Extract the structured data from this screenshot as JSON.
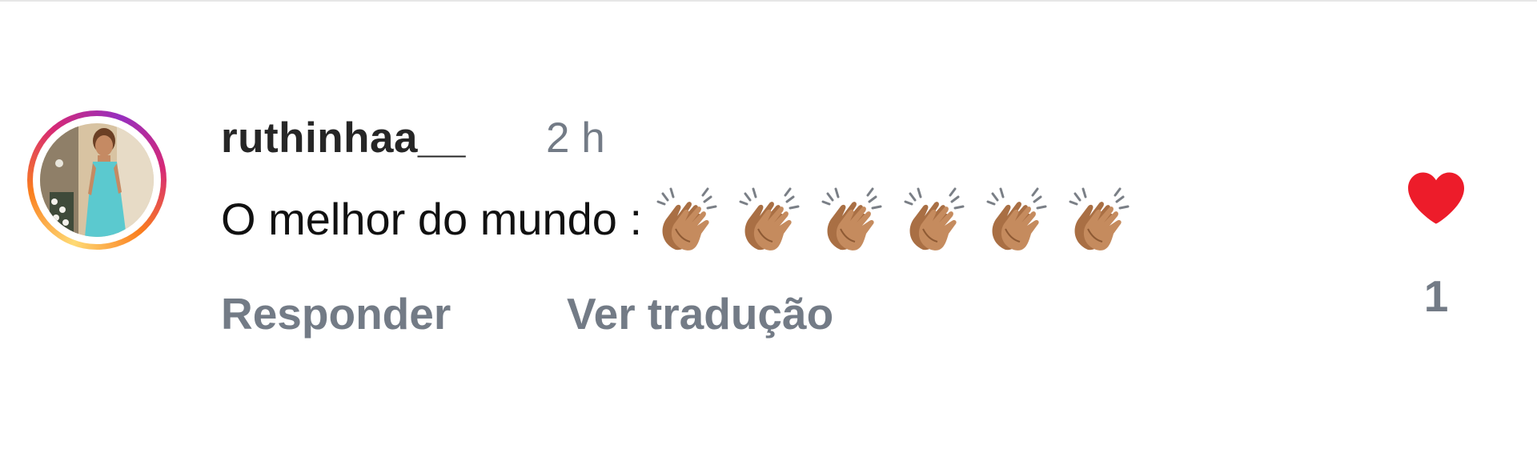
{
  "comment": {
    "username": "ruthinhaa__",
    "time": "2 h",
    "text": "O melhor do mundo :",
    "emoji": [
      "clapping-hands-medium-skin-tone",
      "clapping-hands-medium-skin-tone",
      "clapping-hands-medium-skin-tone",
      "clapping-hands-medium-skin-tone",
      "clapping-hands-medium-skin-tone",
      "clapping-hands-medium-skin-tone"
    ],
    "reply_label": "Responder",
    "translate_label": "Ver tradução",
    "like_count": "1"
  },
  "colors": {
    "heart": "#ed1c2a",
    "secondary_text": "#737b86",
    "primary_text": "#262626"
  }
}
